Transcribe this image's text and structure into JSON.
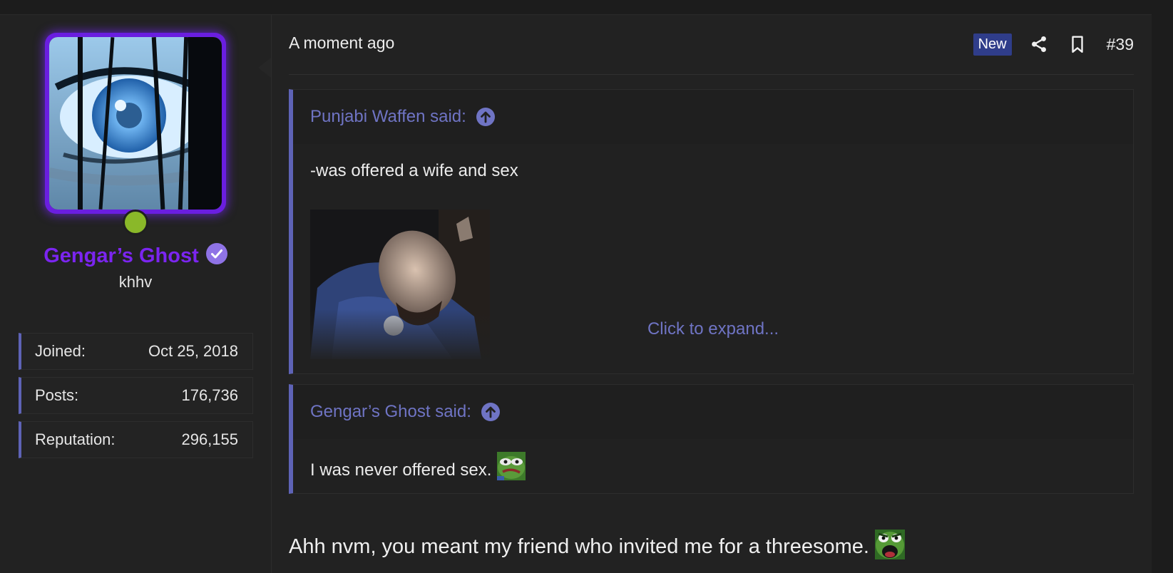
{
  "author": {
    "name": "Gengar’s Ghost",
    "title": "khhv",
    "online_status_color": "#8ab829",
    "verified_icon": "verified-badge-icon",
    "name_color": "#7b25f0",
    "stats": [
      {
        "label": "Joined:",
        "value": "Oct 25, 2018"
      },
      {
        "label": "Posts:",
        "value": "176,736"
      },
      {
        "label": "Reputation:",
        "value": "296,155"
      }
    ]
  },
  "post": {
    "date": "A moment ago",
    "new_badge": "New",
    "number": "#39",
    "icons": [
      "share-icon",
      "bookmark-icon"
    ],
    "quotes": [
      {
        "attribution": "Punjabi Waffen said:",
        "text": "-was offered a wife and sex",
        "expand_label": "Click to expand..."
      },
      {
        "attribution": "Gengar’s Ghost said:",
        "text": "I was never offered sex."
      }
    ],
    "body": "Ahh nvm, you meant my friend who invited me for a threesome."
  },
  "colors": {
    "accent": "#5e63b6",
    "link": "#6f74c4",
    "background": "#1c1c1c",
    "panel": "#222222",
    "new_badge": "#2f3d8a"
  }
}
